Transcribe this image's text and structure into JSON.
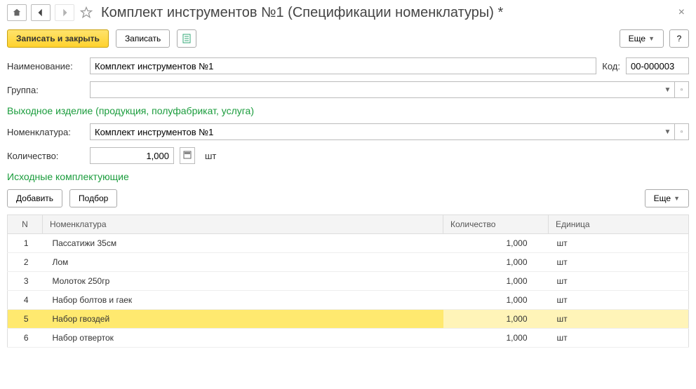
{
  "header": {
    "title": "Комплект инструментов №1 (Спецификации номенклатуры) *"
  },
  "toolbar": {
    "save_close": "Записать и закрыть",
    "save": "Записать",
    "more": "Еще",
    "help": "?"
  },
  "labels": {
    "name": "Наименование:",
    "code": "Код:",
    "group": "Группа:",
    "nomenclature": "Номенклатура:",
    "quantity": "Количество:"
  },
  "fields": {
    "name": "Комплект инструментов №1",
    "code": "00-000003",
    "group": "",
    "nomenclature": "Комплект инструментов №1",
    "quantity": "1,000",
    "unit": "шт"
  },
  "sections": {
    "output": "Выходное изделие (продукция, полуфабрикат, услуга)",
    "components": "Исходные комплектующие"
  },
  "table_toolbar": {
    "add": "Добавить",
    "pick": "Подбор",
    "more": "Еще"
  },
  "table": {
    "headers": {
      "n": "N",
      "nom": "Номенклатура",
      "qty": "Количество",
      "unit": "Единица"
    },
    "rows": [
      {
        "n": "1",
        "nom": "Пассатижи 35см",
        "qty": "1,000",
        "unit": "шт"
      },
      {
        "n": "2",
        "nom": "Лом",
        "qty": "1,000",
        "unit": "шт"
      },
      {
        "n": "3",
        "nom": "Молоток 250гр",
        "qty": "1,000",
        "unit": "шт"
      },
      {
        "n": "4",
        "nom": "Набор болтов и гаек",
        "qty": "1,000",
        "unit": "шт"
      },
      {
        "n": "5",
        "nom": "Набор гвоздей",
        "qty": "1,000",
        "unit": "шт",
        "selected": true
      },
      {
        "n": "6",
        "nom": "Набор отверток",
        "qty": "1,000",
        "unit": "шт"
      }
    ]
  }
}
